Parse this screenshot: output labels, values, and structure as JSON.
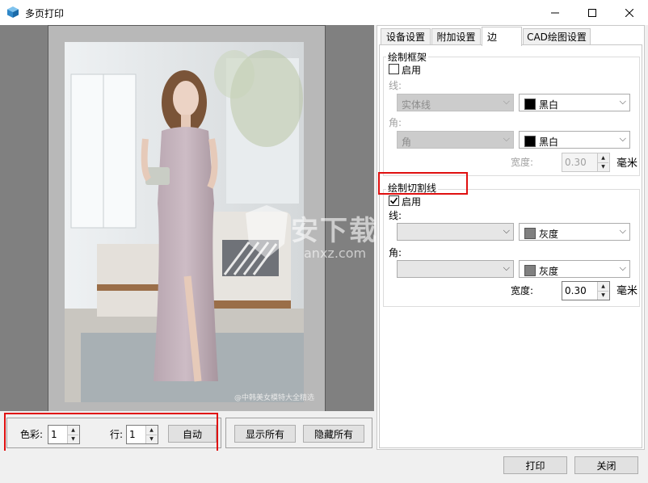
{
  "window": {
    "title": "多页打印",
    "controls": {
      "minimize": "—",
      "maximize": "☐",
      "close": "✕"
    }
  },
  "preview": {
    "watermark_text": "安下载",
    "watermark_sub": "anxz.com",
    "photo_caption": "@中韩美女模特大全精选"
  },
  "bottom": {
    "color_label": "色彩:",
    "color_value": "1",
    "row_label": "行:",
    "row_value": "1",
    "auto_button": "自动",
    "show_all_button": "显示所有",
    "hide_all_button": "隐藏所有"
  },
  "tabs": [
    {
      "label": "设备设置",
      "active": false
    },
    {
      "label": "附加设置",
      "active": false
    },
    {
      "label": "边",
      "active": true
    },
    {
      "label": "CAD绘图设置",
      "active": false
    }
  ],
  "frame_group": {
    "legend": "绘制框架",
    "enable_label": "启用",
    "enabled": false,
    "line_label": "线:",
    "line_style": "实体线",
    "line_color": "黑白",
    "corner_label": "角:",
    "corner_style": "角",
    "corner_color": "黑白",
    "width_label": "宽度:",
    "width_value": "0.30",
    "unit": "毫米"
  },
  "cut_group": {
    "legend": "绘制切割线",
    "enable_label": "启用",
    "enabled": true,
    "line_label": "线:",
    "line_style": "",
    "line_color": "灰度",
    "corner_label": "角:",
    "corner_style": "",
    "corner_color": "灰度",
    "width_label": "宽度:",
    "width_value": "0.30",
    "unit": "毫米"
  },
  "footer": {
    "print_button": "打印",
    "close_button": "关闭"
  },
  "colors": {
    "black_swatch": "#000000",
    "gray_swatch": "#808080",
    "highlight": "#e01010",
    "preview_bg": "#808080"
  },
  "icons": {
    "app": "app-cube-icon",
    "check": "checkmark-icon",
    "dropdown": "chevron-down-icon",
    "spin_up": "spin-up-icon",
    "spin_down": "spin-down-icon"
  }
}
